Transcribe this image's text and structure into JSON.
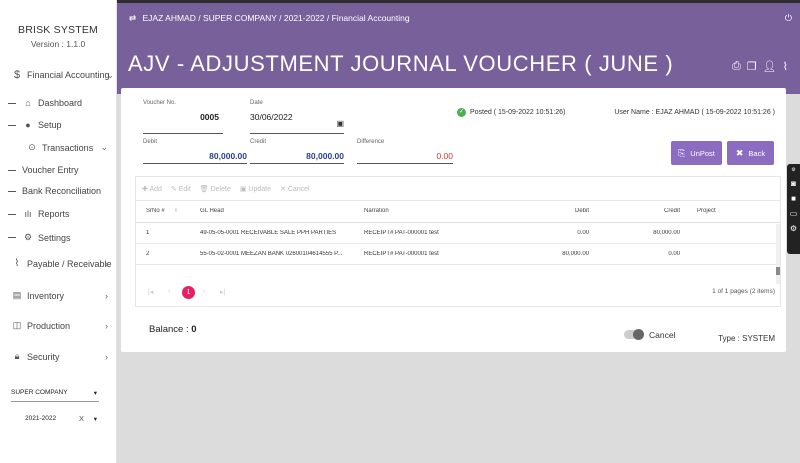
{
  "sidebar": {
    "brand": "BRISK SYSTEM",
    "version": "Version : 1.1.0",
    "items": [
      {
        "label": "Financial Accounting",
        "icon": "dollar-icon"
      },
      {
        "label": "Dashboard",
        "icon": "home-icon"
      },
      {
        "label": "Setup",
        "icon": "circle-icon"
      },
      {
        "label": "Transactions",
        "icon": "gear-icon"
      },
      {
        "label": "Voucher Entry"
      },
      {
        "label": "Bank Reconciliation"
      },
      {
        "label": "Reports",
        "icon": "bar-chart-icon"
      },
      {
        "label": "Settings",
        "icon": "gear-icon"
      },
      {
        "label": "Payable / Receivable",
        "icon": "paperclip-icon"
      },
      {
        "label": "Inventory",
        "icon": "calendar-icon"
      },
      {
        "label": "Production",
        "icon": "map-icon"
      },
      {
        "label": "Security",
        "icon": "lock-icon"
      }
    ],
    "company": "SUPER COMPANY",
    "year": "2021-2022",
    "year_clear": "X"
  },
  "topbar": {
    "breadcrumb": "EJAZ AHMAD / SUPER COMPANY / 2021-2022 / Financial Accounting"
  },
  "header": {
    "title": "AJV - ADJUSTMENT JOURNAL VOUCHER ( JUNE )"
  },
  "form": {
    "voucher_no_label": "Voucher No.",
    "voucher_no": "0005",
    "date_label": "Date",
    "date": "30/06/2022",
    "posted": "Posted ( 15-09-2022 10:51:26)",
    "user": "User Name : EJAZ AHMAD ( 15-09-2022 10:51:26 )",
    "debit_label": "Debit",
    "debit": "80,000.00",
    "credit_label": "Credit",
    "credit": "80,000.00",
    "difference_label": "Difference",
    "difference": "0.00",
    "unpost_label": "UnPost",
    "back_label": "Back"
  },
  "grid": {
    "toolbar": [
      "Add",
      "Edit",
      "Delete",
      "Update",
      "Cancel"
    ],
    "columns": {
      "srno": "SrNo #",
      "glhead": "GL Head",
      "narration": "Narration",
      "debit": "Debit",
      "credit": "Credit",
      "project": "Project"
    },
    "rows": [
      {
        "srno": "1",
        "glhead": "49-05-05-0001 RECEIVABLE SALE PPH PARTIES",
        "narration": "RECEIPT# PAT-000001 test",
        "debit": "0.00",
        "credit": "80,000.00",
        "project": ""
      },
      {
        "srno": "2",
        "glhead": "55-05-02-0001 MEEZAN BANK 02600104614555 P...",
        "narration": "RECEIPT# PAT-000001 test",
        "debit": "80,000.00",
        "credit": "0.00",
        "project": ""
      }
    ],
    "page_current": "1",
    "page_info": "1 of 1 pages (2 items)"
  },
  "footer": {
    "balance_label": "Balance :",
    "balance_value": "0",
    "cancel_label": "Cancel",
    "type_label": "Type : SYSTEM"
  },
  "colors": {
    "header_purple": "#78609a",
    "button_purple": "#8c6cc0",
    "debit_blue": "#2a3f8f",
    "difference_red": "#d33",
    "page_active": "#e91e63",
    "posted_green": "#4caf50"
  }
}
